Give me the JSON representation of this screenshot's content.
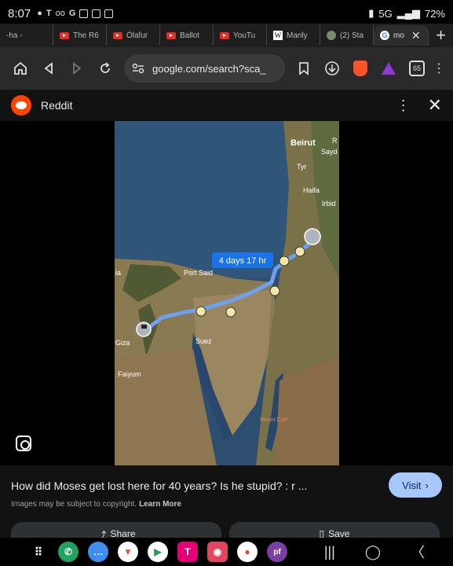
{
  "status": {
    "time": "8:07",
    "network": "5G",
    "battery": "72%"
  },
  "tabs": [
    {
      "label": "-ha -",
      "icon": "generic-icon"
    },
    {
      "label": "The R6",
      "icon": "youtube-icon"
    },
    {
      "label": "Ólafur",
      "icon": "youtube-icon"
    },
    {
      "label": "Ballot",
      "icon": "youtube-icon"
    },
    {
      "label": "YouTu",
      "icon": "youtube-icon"
    },
    {
      "label": "Manly",
      "icon": "wikipedia-icon"
    },
    {
      "label": "(2) Sta",
      "icon": "globe-icon"
    },
    {
      "label": "mo",
      "icon": "google-icon",
      "active": true
    }
  ],
  "toolbar": {
    "url": "google.com/search?sca_",
    "tab_count": "65"
  },
  "sheet": {
    "source": "Reddit"
  },
  "map": {
    "route_label": "4 days 17 hr",
    "places": [
      "Beirut",
      "Sayd",
      "Tyr",
      "Haifa",
      "Irbid",
      "Port Said",
      "Suez",
      "Giza",
      "Faiyum",
      "ia",
      "R",
      "Mount Cath"
    ]
  },
  "result": {
    "caption": "How did Moses get lost here for 40 years? Is he stupid? : r ...",
    "visit_label": "Visit",
    "copyright": "Images may be subject to copyright.",
    "learn_more": "Learn More",
    "share_label": "Share",
    "save_label": "Save"
  }
}
